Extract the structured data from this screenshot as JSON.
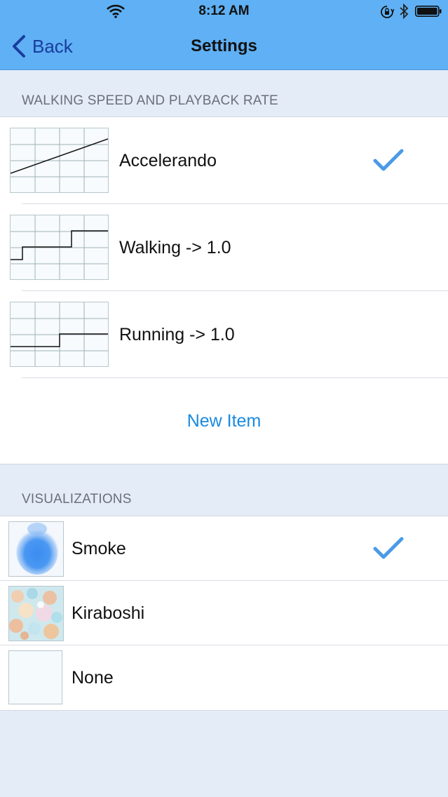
{
  "status_bar": {
    "time": "8:12 AM",
    "icons": [
      "wifi-icon",
      "orientation-lock-icon",
      "bluetooth-icon",
      "battery-icon"
    ]
  },
  "nav": {
    "back_label": "Back",
    "title": "Settings"
  },
  "sections": {
    "speed": {
      "header": "WALKING SPEED AND PLAYBACK RATE",
      "items": [
        {
          "label": "Accelerando",
          "checked": true,
          "graph": "linear-increase"
        },
        {
          "label": "Walking -> 1.0",
          "checked": false,
          "graph": "step-up"
        },
        {
          "label": "Running -> 1.0",
          "checked": false,
          "graph": "step-up-single"
        }
      ],
      "new_item_label": "New Item"
    },
    "visualizations": {
      "header": "VISUALIZATIONS",
      "items": [
        {
          "label": "Smoke",
          "checked": true,
          "thumb": "blue-smoke"
        },
        {
          "label": "Kiraboshi",
          "checked": false,
          "thumb": "pastel-bokeh"
        },
        {
          "label": "None",
          "checked": false,
          "thumb": "blank"
        }
      ]
    }
  },
  "colors": {
    "bar": "#5fb0f4",
    "accent": "#1a8ae0",
    "check": "#4a9ae8",
    "background": "#e4ecf8"
  }
}
